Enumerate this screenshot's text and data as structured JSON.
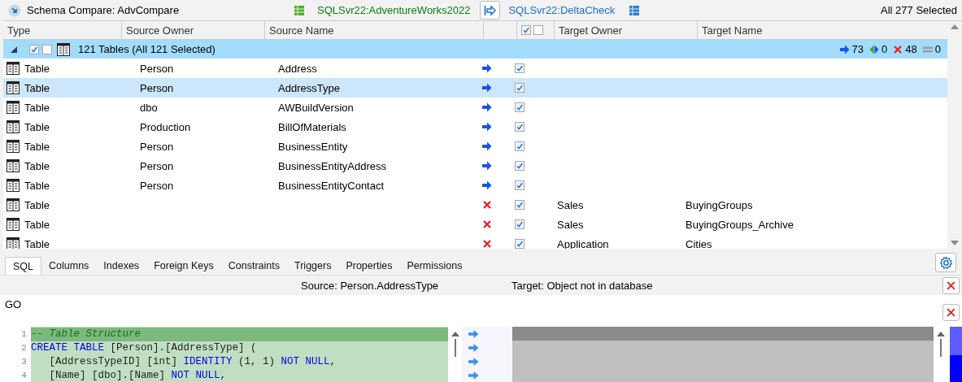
{
  "window": {
    "title": "Schema Compare: AdvCompare"
  },
  "source_db": "SQLSvr22:AdventureWorks2022",
  "target_db": "SQLSvr22:DeltaCheck",
  "selection_summary": "All 277 Selected",
  "columns": [
    "Type",
    "Source Owner",
    "Source Name",
    "Target Owner",
    "Target Name"
  ],
  "header_checks": [
    {
      "checked": true
    },
    {
      "checked": false
    }
  ],
  "group": {
    "label": "121 Tables (All 121 Selected)",
    "expanded": true,
    "checks": [
      {
        "checked": true
      },
      {
        "checked": false
      }
    ],
    "counts": [
      {
        "kind": "add",
        "count": "73"
      },
      {
        "kind": "update",
        "count": "0"
      },
      {
        "kind": "remove",
        "count": "48"
      },
      {
        "kind": "equal",
        "count": "0"
      }
    ]
  },
  "rows": [
    {
      "type": "Table",
      "source_owner": "Person",
      "source_name": "Address",
      "kind": "add",
      "checked": true,
      "selected": false
    },
    {
      "type": "Table",
      "source_owner": "Person",
      "source_name": "AddressType",
      "kind": "add",
      "checked": true,
      "selected": true
    },
    {
      "type": "Table",
      "source_owner": "dbo",
      "source_name": "AWBuildVersion",
      "kind": "add",
      "checked": true,
      "selected": false
    },
    {
      "type": "Table",
      "source_owner": "Production",
      "source_name": "BillOfMaterials",
      "kind": "add",
      "checked": true,
      "selected": false
    },
    {
      "type": "Table",
      "source_owner": "Person",
      "source_name": "BusinessEntity",
      "kind": "add",
      "checked": true,
      "selected": false
    },
    {
      "type": "Table",
      "source_owner": "Person",
      "source_name": "BusinessEntityAddress",
      "kind": "add",
      "checked": true,
      "selected": false
    },
    {
      "type": "Table",
      "source_owner": "Person",
      "source_name": "BusinessEntityContact",
      "kind": "add",
      "checked": true,
      "selected": false
    },
    {
      "type": "Table",
      "kind": "remove",
      "checked": true,
      "selected": false,
      "target_owner": "Sales",
      "target_name": "BuyingGroups"
    },
    {
      "type": "Table",
      "kind": "remove",
      "checked": true,
      "selected": false,
      "target_owner": "Sales",
      "target_name": "BuyingGroups_Archive"
    },
    {
      "type": "Table",
      "kind": "remove",
      "checked": true,
      "selected": false,
      "target_owner": "Application",
      "target_name": "Cities"
    }
  ],
  "tabs": [
    {
      "label": "SQL",
      "selected": true
    },
    {
      "label": "Columns",
      "selected": false
    },
    {
      "label": "Indexes",
      "selected": false
    },
    {
      "label": "Foreign Keys",
      "selected": false
    },
    {
      "label": "Constraints",
      "selected": false
    },
    {
      "label": "Triggers",
      "selected": false
    },
    {
      "label": "Properties",
      "selected": false
    },
    {
      "label": "Permissions",
      "selected": false
    }
  ],
  "source_label": "Source: Person.AddressType",
  "target_label": "Target: Object not in database",
  "script_text": "GO",
  "code_lines": [
    {
      "number": "1",
      "tokens": [
        {
          "kind": "comment",
          "text": "-- Table Structure"
        }
      ]
    },
    {
      "number": "2",
      "tokens": [
        {
          "kind": "keyword",
          "text": "CREATE TABLE"
        },
        {
          "kind": "plain",
          "text": " [Person].[AddressType] ("
        }
      ]
    },
    {
      "number": "3",
      "tokens": [
        {
          "kind": "plain",
          "text": "   [AddressTypeID] [int] "
        },
        {
          "kind": "keyword",
          "text": "IDENTITY"
        },
        {
          "kind": "plain",
          "text": " (1, 1) "
        },
        {
          "kind": "keyword",
          "text": "NOT NULL"
        },
        {
          "kind": "plain",
          "text": ","
        }
      ]
    },
    {
      "number": "4",
      "tokens": [
        {
          "kind": "plain",
          "text": "   [Name] [dbo].[Name] "
        },
        {
          "kind": "keyword",
          "text": "NOT NULL"
        },
        {
          "kind": "plain",
          "text": ","
        }
      ]
    }
  ]
}
